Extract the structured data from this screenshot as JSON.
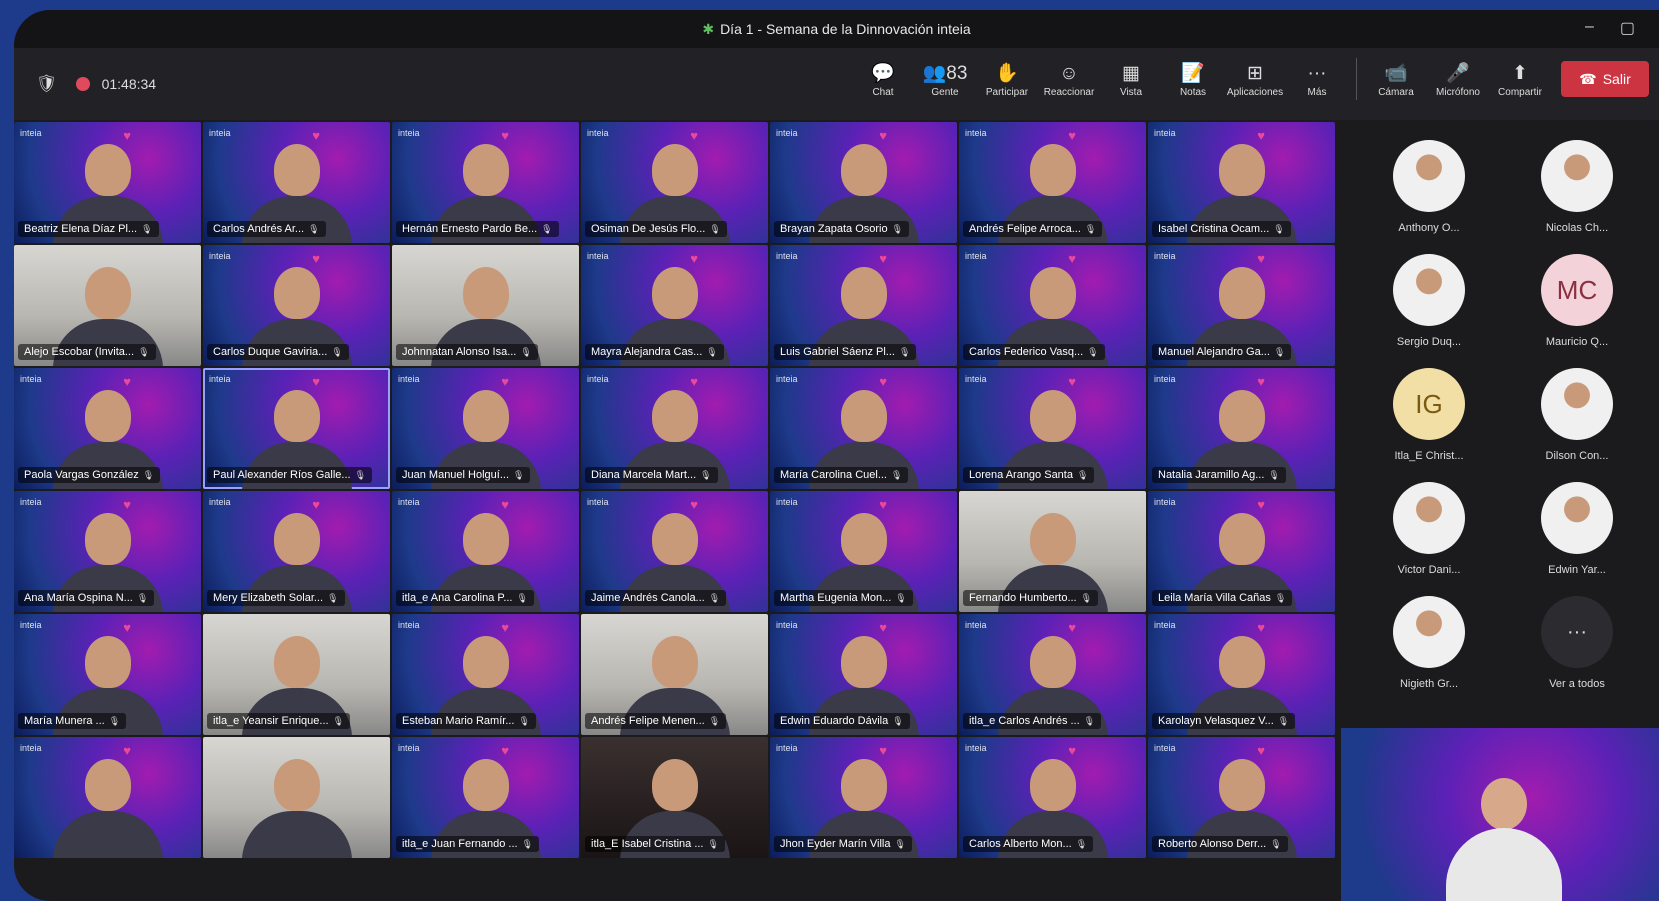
{
  "window": {
    "title": "Día 1 - Semana de la Dinnovación inteia",
    "minimize": "–",
    "restore": "▢"
  },
  "toolbar": {
    "timer": "01:48:34",
    "people_count": "83",
    "tools": [
      {
        "label": "Chat",
        "icon": "💬"
      },
      {
        "label": "Gente",
        "icon": "👥"
      },
      {
        "label": "Participar",
        "icon": "✋"
      },
      {
        "label": "Reaccionar",
        "icon": "☺"
      },
      {
        "label": "Vista",
        "icon": "▦"
      },
      {
        "label": "Notas",
        "icon": "📝"
      },
      {
        "label": "Aplicaciones",
        "icon": "⊞"
      },
      {
        "label": "Más",
        "icon": "···"
      }
    ],
    "media": [
      {
        "label": "Cámara",
        "icon": "📹"
      },
      {
        "label": "Micrófono",
        "icon": "🎤"
      },
      {
        "label": "Compartir",
        "icon": "⬆"
      }
    ],
    "leave_label": "Salir"
  },
  "tiles": [
    {
      "name": "Beatriz Elena Díaz Pl...",
      "style": "promo"
    },
    {
      "name": "Carlos Andrés Ar...",
      "style": "promo"
    },
    {
      "name": "Hernán Ernesto Pardo Be...",
      "style": "promo"
    },
    {
      "name": "Osiman De Jesús Flo...",
      "style": "promo"
    },
    {
      "name": "Brayan Zapata Osorio",
      "style": "promo"
    },
    {
      "name": "Andrés Felipe Arroca...",
      "style": "promo"
    },
    {
      "name": "Isabel Cristina Ocam...",
      "style": "promo"
    },
    {
      "name": "Alejo Escobar (Invita...",
      "style": "office"
    },
    {
      "name": "Carlos Duque Gaviria...",
      "style": "promo"
    },
    {
      "name": "Johnnatan Alonso Isa...",
      "style": "office"
    },
    {
      "name": "Mayra Alejandra Cas...",
      "style": "promo"
    },
    {
      "name": "Luis Gabriel Sáenz Pl...",
      "style": "promo"
    },
    {
      "name": "Carlos Federico Vasq...",
      "style": "promo"
    },
    {
      "name": "Manuel Alejandro Ga...",
      "style": "promo"
    },
    {
      "name": "Paola Vargas González",
      "style": "promo"
    },
    {
      "name": "Paul Alexander Ríos Galle...",
      "style": "promo"
    },
    {
      "name": "Juan Manuel Holguí...",
      "style": "promo"
    },
    {
      "name": "Diana Marcela Mart...",
      "style": "promo"
    },
    {
      "name": "María Carolina Cuel...",
      "style": "promo"
    },
    {
      "name": "Lorena Arango Santa",
      "style": "promo"
    },
    {
      "name": "Natalia Jaramillo Ag...",
      "style": "promo"
    },
    {
      "name": "Ana María Ospina N...",
      "style": "promo"
    },
    {
      "name": "Mery Elizabeth Solar...",
      "style": "promo"
    },
    {
      "name": "itla_e Ana Carolina P...",
      "style": "promo"
    },
    {
      "name": "Jaime Andrés Canola...",
      "style": "promo"
    },
    {
      "name": "Martha Eugenia Mon...",
      "style": "promo"
    },
    {
      "name": "Fernando Humberto...",
      "style": "office"
    },
    {
      "name": "Leila María Villa Cañas",
      "style": "promo"
    },
    {
      "name": "María Munera ...",
      "style": "promo"
    },
    {
      "name": "itla_e Yeansir Enrique...",
      "style": "office"
    },
    {
      "name": "Esteban Mario Ramír...",
      "style": "promo"
    },
    {
      "name": "Andrés Felipe Menen...",
      "style": "office"
    },
    {
      "name": "Edwin Eduardo Dávila",
      "style": "promo"
    },
    {
      "name": "itla_e Carlos Andrés ...",
      "style": "promo"
    },
    {
      "name": "Karolayn Velasquez V...",
      "style": "promo"
    },
    {
      "name": "",
      "style": "promo"
    },
    {
      "name": "",
      "style": "office"
    },
    {
      "name": "itla_e Juan Fernando ...",
      "style": "promo"
    },
    {
      "name": "itla_E Isabel Cristina ...",
      "style": "dark"
    },
    {
      "name": "Jhon Eyder Marín Villa",
      "style": "promo"
    },
    {
      "name": "Carlos Alberto Mon...",
      "style": "promo"
    },
    {
      "name": "Roberto Alonso Derr...",
      "style": "promo"
    }
  ],
  "sidebar": [
    {
      "name": "Anthony O...",
      "avatar": "photo",
      "initials": ""
    },
    {
      "name": "Nicolas Ch...",
      "avatar": "photo",
      "initials": ""
    },
    {
      "name": "Sergio Duq...",
      "avatar": "photo",
      "initials": ""
    },
    {
      "name": "Mauricio Q...",
      "avatar": "mc",
      "initials": "MC"
    },
    {
      "name": "Itla_E Christ...",
      "avatar": "ig",
      "initials": "IG"
    },
    {
      "name": "Dilson Con...",
      "avatar": "photo",
      "initials": ""
    },
    {
      "name": "Victor Dani...",
      "avatar": "photo",
      "initials": ""
    },
    {
      "name": "Edwin Yar...",
      "avatar": "photo",
      "initials": ""
    },
    {
      "name": "Nigieth Gr...",
      "avatar": "photo",
      "initials": ""
    },
    {
      "name": "Ver a todos",
      "avatar": "more",
      "initials": "···"
    }
  ],
  "colors": {
    "accent": "#cc3442",
    "promo_purple": "#5b21b6",
    "promo_pink": "#a21caf",
    "bg_blue": "#1e3a8a"
  },
  "tile_logo": "inteia"
}
